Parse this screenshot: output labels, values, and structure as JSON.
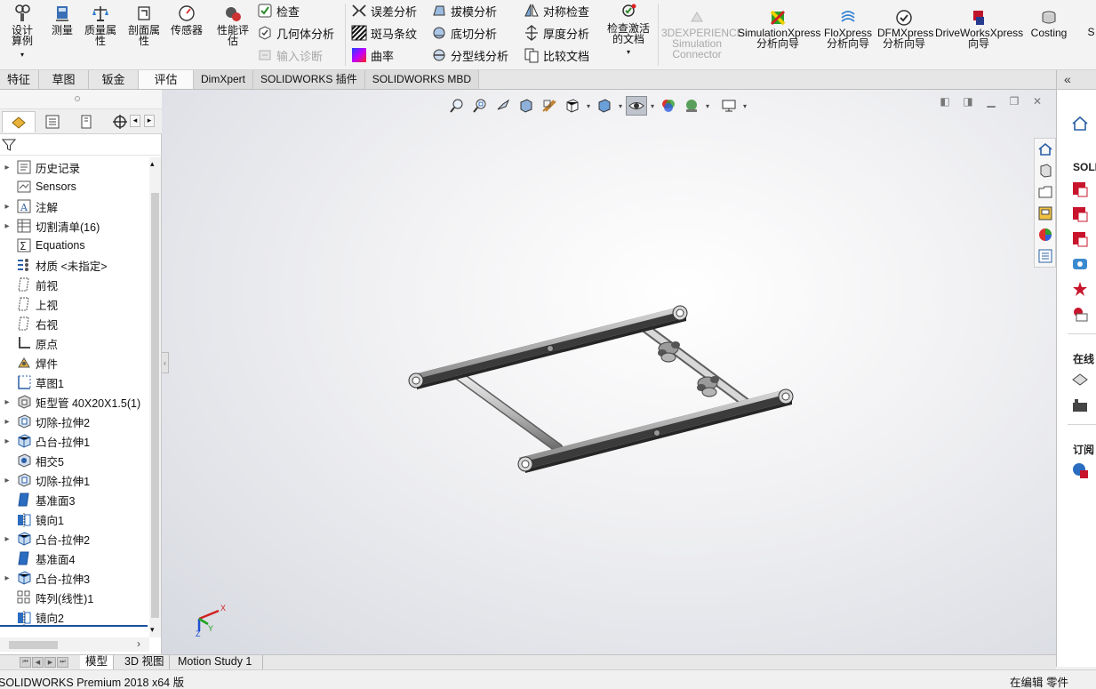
{
  "ribbon": {
    "design_study": "设计算例",
    "measure": "测量",
    "mass_properties": "质量属性",
    "section_properties": "剖面属性",
    "sensors": "传感器",
    "performance_eval": "性能评估",
    "check": "检查",
    "geometry_analysis": "几何体分析",
    "import_diagnostics": "输入诊断",
    "deviation_analysis": "误差分析",
    "zebra_stripes": "斑马条纹",
    "curvature": "曲率",
    "draft_analysis": "拔模分析",
    "undercut_analysis": "底切分析",
    "parting_line_analysis": "分型线分析",
    "symmetry_check": "对称检查",
    "thickness_analysis": "厚度分析",
    "compare_documents": "比较文档",
    "check_active_doc": "检查激活的文档",
    "addins": [
      {
        "label": "3DEXPERIENCE Simulation Connector",
        "disabled": true
      },
      {
        "label": "SimulationXpress 分析向导"
      },
      {
        "label": "FloXpress 分析向导"
      },
      {
        "label": "DFMXpress 分析向导"
      },
      {
        "label": "DriveWorksXpress 向导"
      },
      {
        "label": "Costing"
      },
      {
        "label": "S"
      }
    ]
  },
  "tabs": [
    "特征",
    "草图",
    "钣金",
    "评估",
    "DimXpert",
    "SOLIDWORKS 插件",
    "SOLIDWORKS MBD"
  ],
  "active_tab": "评估",
  "tree": {
    "items": [
      {
        "label": "历史记录",
        "icon": "history-icon",
        "expandable": true
      },
      {
        "label": "Sensors",
        "icon": "sensors-icon",
        "expandable": false
      },
      {
        "label": "注解",
        "icon": "annotations-icon",
        "expandable": true
      },
      {
        "label": "切割清单(16)",
        "icon": "cut-list-icon",
        "expandable": true
      },
      {
        "label": "Equations",
        "icon": "equations-icon",
        "expandable": false
      },
      {
        "label": "材质 <未指定>",
        "icon": "material-icon",
        "expandable": false
      },
      {
        "label": "前视",
        "icon": "plane-icon",
        "expandable": false
      },
      {
        "label": "上视",
        "icon": "plane-icon",
        "expandable": false
      },
      {
        "label": "右视",
        "icon": "plane-icon",
        "expandable": false
      },
      {
        "label": "原点",
        "icon": "origin-icon",
        "expandable": false
      },
      {
        "label": "焊件",
        "icon": "weldment-icon",
        "expandable": false
      },
      {
        "label": "草图1",
        "icon": "sketch-icon",
        "expandable": false
      },
      {
        "label": "矩型管 40X20X1.5(1)",
        "icon": "structural-member-icon",
        "expandable": true
      },
      {
        "label": "切除-拉伸2",
        "icon": "cut-extrude-icon",
        "expandable": true
      },
      {
        "label": "凸台-拉伸1",
        "icon": "boss-extrude-icon",
        "expandable": true
      },
      {
        "label": "相交5",
        "icon": "intersect-icon",
        "expandable": false
      },
      {
        "label": "切除-拉伸1",
        "icon": "cut-extrude-icon",
        "expandable": true
      },
      {
        "label": "基准面3",
        "icon": "ref-plane-icon",
        "expandable": false
      },
      {
        "label": "镜向1",
        "icon": "mirror-icon",
        "expandable": false
      },
      {
        "label": "凸台-拉伸2",
        "icon": "boss-extrude-icon",
        "expandable": true
      },
      {
        "label": "基准面4",
        "icon": "ref-plane-icon",
        "expandable": false
      },
      {
        "label": "凸台-拉伸3",
        "icon": "boss-extrude-icon",
        "expandable": true
      },
      {
        "label": "阵列(线性)1",
        "icon": "linear-pattern-icon",
        "expandable": false
      },
      {
        "label": "镜向2",
        "icon": "mirror-icon",
        "expandable": false
      }
    ]
  },
  "viewport": {
    "triad": {
      "x": "X",
      "y": "Y",
      "z": "Z"
    }
  },
  "taskpane": {
    "solid_label": "SOLID",
    "online_label": "在线",
    "subscribe_label": "订阅"
  },
  "bottom_tabs": [
    "模型",
    "3D 视图",
    "Motion Study 1"
  ],
  "active_bottom_tab": "模型",
  "status": {
    "app": "SOLIDWORKS Premium 2018 x64 版",
    "mode": "在编辑 零件"
  }
}
